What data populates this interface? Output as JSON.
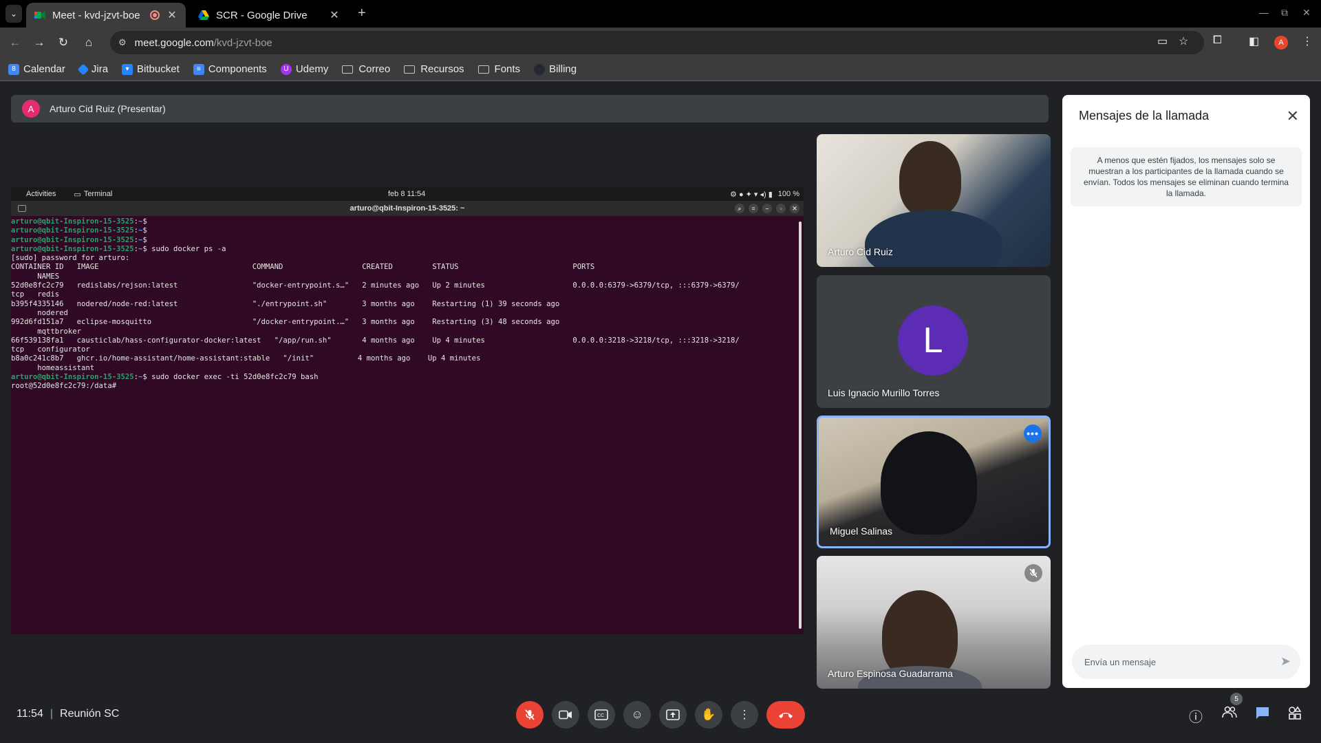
{
  "browser": {
    "tabs": [
      {
        "title": "Meet - kvd-jzvt-boe",
        "active": true,
        "recording": true
      },
      {
        "title": "SCR - Google Drive",
        "active": false
      }
    ],
    "url_host": "meet.google.com",
    "url_path": "/kvd-jzvt-boe",
    "profile_initial": "A",
    "bookmarks": [
      {
        "label": "Calendar",
        "icon": "calendar-icon"
      },
      {
        "label": "Jira",
        "icon": "jira-icon"
      },
      {
        "label": "Bitbucket",
        "icon": "bitbucket-icon"
      },
      {
        "label": "Components",
        "icon": "docs-icon"
      },
      {
        "label": "Udemy",
        "icon": "udemy-icon"
      },
      {
        "label": "Correo",
        "icon": "folder-icon"
      },
      {
        "label": "Recursos",
        "icon": "folder-icon"
      },
      {
        "label": "Fonts",
        "icon": "folder-icon"
      },
      {
        "label": "Billing",
        "icon": "github-icon"
      }
    ]
  },
  "meet": {
    "presenter": {
      "initial": "A",
      "label": "Arturo Cid Ruiz (Presentar)"
    },
    "shared_screen": {
      "topbar": {
        "activities": "Activities",
        "app": "Terminal",
        "datetime": "feb 8  11:54",
        "battery": "100 %"
      },
      "terminal_title": "arturo@qbit-Inspiron-15-3525: ~",
      "prompt": "arturo@qbit-Inspiron-15-3525",
      "lines": {
        "l1": "$",
        "l2": "$",
        "l3": "$",
        "l4": "$ sudo docker ps -a",
        "l5": "[sudo] password for arturo:",
        "header": "CONTAINER ID   IMAGE                                   COMMAND                  CREATED         STATUS                          PORTS",
        "header2": "      NAMES",
        "r1": "52d0e8fc2c79   redislabs/rejson:latest                 \"docker-entrypoint.s…\"   2 minutes ago   Up 2 minutes                    0.0.0.0:6379->6379/tcp, :::6379->6379/",
        "r1b": "tcp   redis",
        "r2": "b395f4335146   nodered/node-red:latest                 \"./entrypoint.sh\"        3 months ago    Restarting (1) 39 seconds ago",
        "r2b": "      nodered",
        "r3": "992d6fd151a7   eclipse-mosquitto                       \"/docker-entrypoint.…\"   3 months ago    Restarting (3) 48 seconds ago",
        "r3b": "      mqttbroker",
        "r4": "66f539138fa1   causticlab/hass-configurator-docker:latest   \"/app/run.sh\"       4 months ago    Up 4 minutes                    0.0.0.0:3218->3218/tcp, :::3218->3218/",
        "r4b": "tcp   configurator",
        "r5": "b8a0c241c8b7   ghcr.io/home-assistant/home-assistant:stable   \"/init\"          4 months ago    Up 4 minutes",
        "r5b": "      homeassistant",
        "l6": "$ sudo docker exec -ti 52d0e8fc2c79 bash",
        "l7": "root@52d0e8fc2c79:/data#"
      }
    },
    "participants": [
      {
        "name": "Arturo Cid Ruiz"
      },
      {
        "name": "Luis Ignacio Murillo Torres",
        "initial": "L"
      },
      {
        "name": "Miguel Salinas"
      },
      {
        "name": "Arturo Espinosa Guadarrama"
      }
    ],
    "chat": {
      "title": "Mensajes de la llamada",
      "notice": "A menos que estén fijados, los mensajes solo se muestran a los participantes de la llamada cuando se envían. Todos los mensajes se eliminan cuando termina la llamada.",
      "input_placeholder": "Envía un mensaje"
    },
    "footer": {
      "time": "11:54",
      "meeting_name": "Reunión SC",
      "people_count": "5"
    }
  }
}
